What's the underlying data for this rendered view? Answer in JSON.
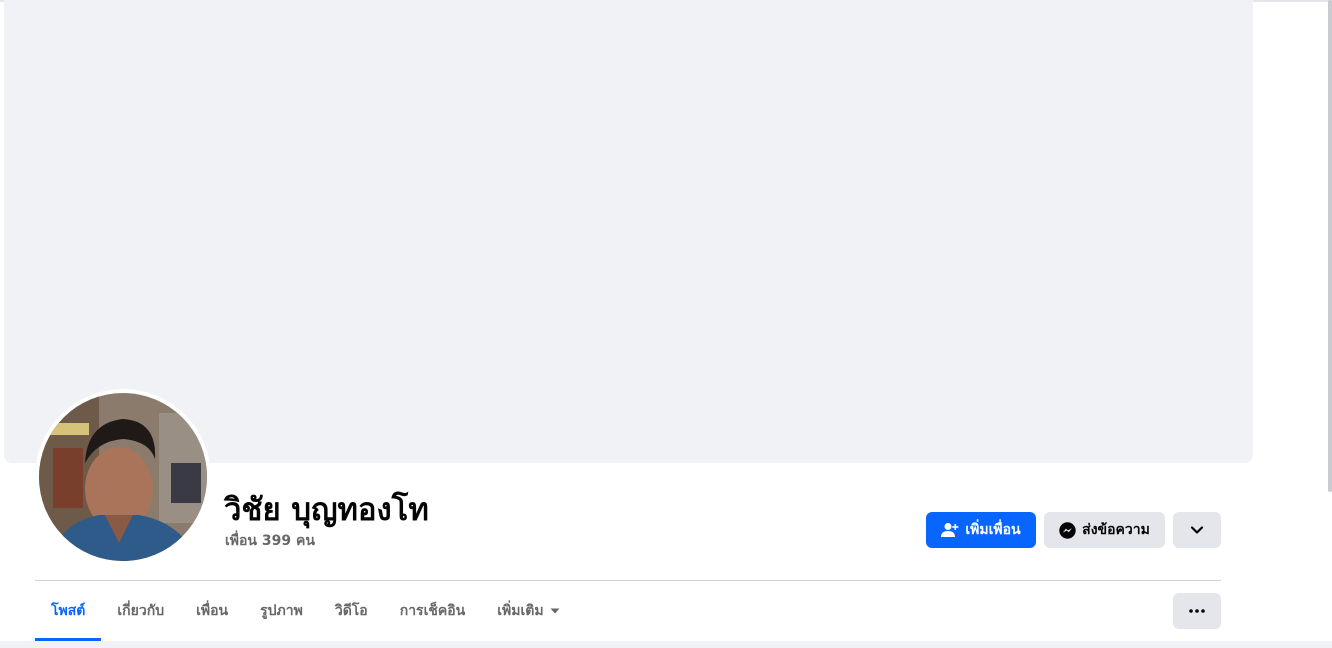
{
  "profile": {
    "name": "วิชัย บุญทองโท",
    "friends_count": "เพื่อน 399 คน"
  },
  "actions": {
    "add_friend_label": "เพิ่มเพื่อน",
    "message_label": "ส่งข้อความ"
  },
  "tabs": [
    {
      "label": "โพสต์",
      "active": true
    },
    {
      "label": "เกี่ยวกับ",
      "active": false
    },
    {
      "label": "เพื่อน",
      "active": false
    },
    {
      "label": "รูปภาพ",
      "active": false
    },
    {
      "label": "วิดีโอ",
      "active": false
    },
    {
      "label": "การเช็คอิน",
      "active": false
    },
    {
      "label": "เพิ่มเติม",
      "active": false
    }
  ],
  "colors": {
    "accent": "#0866ff",
    "secondary_button": "#e4e6eb",
    "cover_placeholder": "#f0f2f5"
  }
}
